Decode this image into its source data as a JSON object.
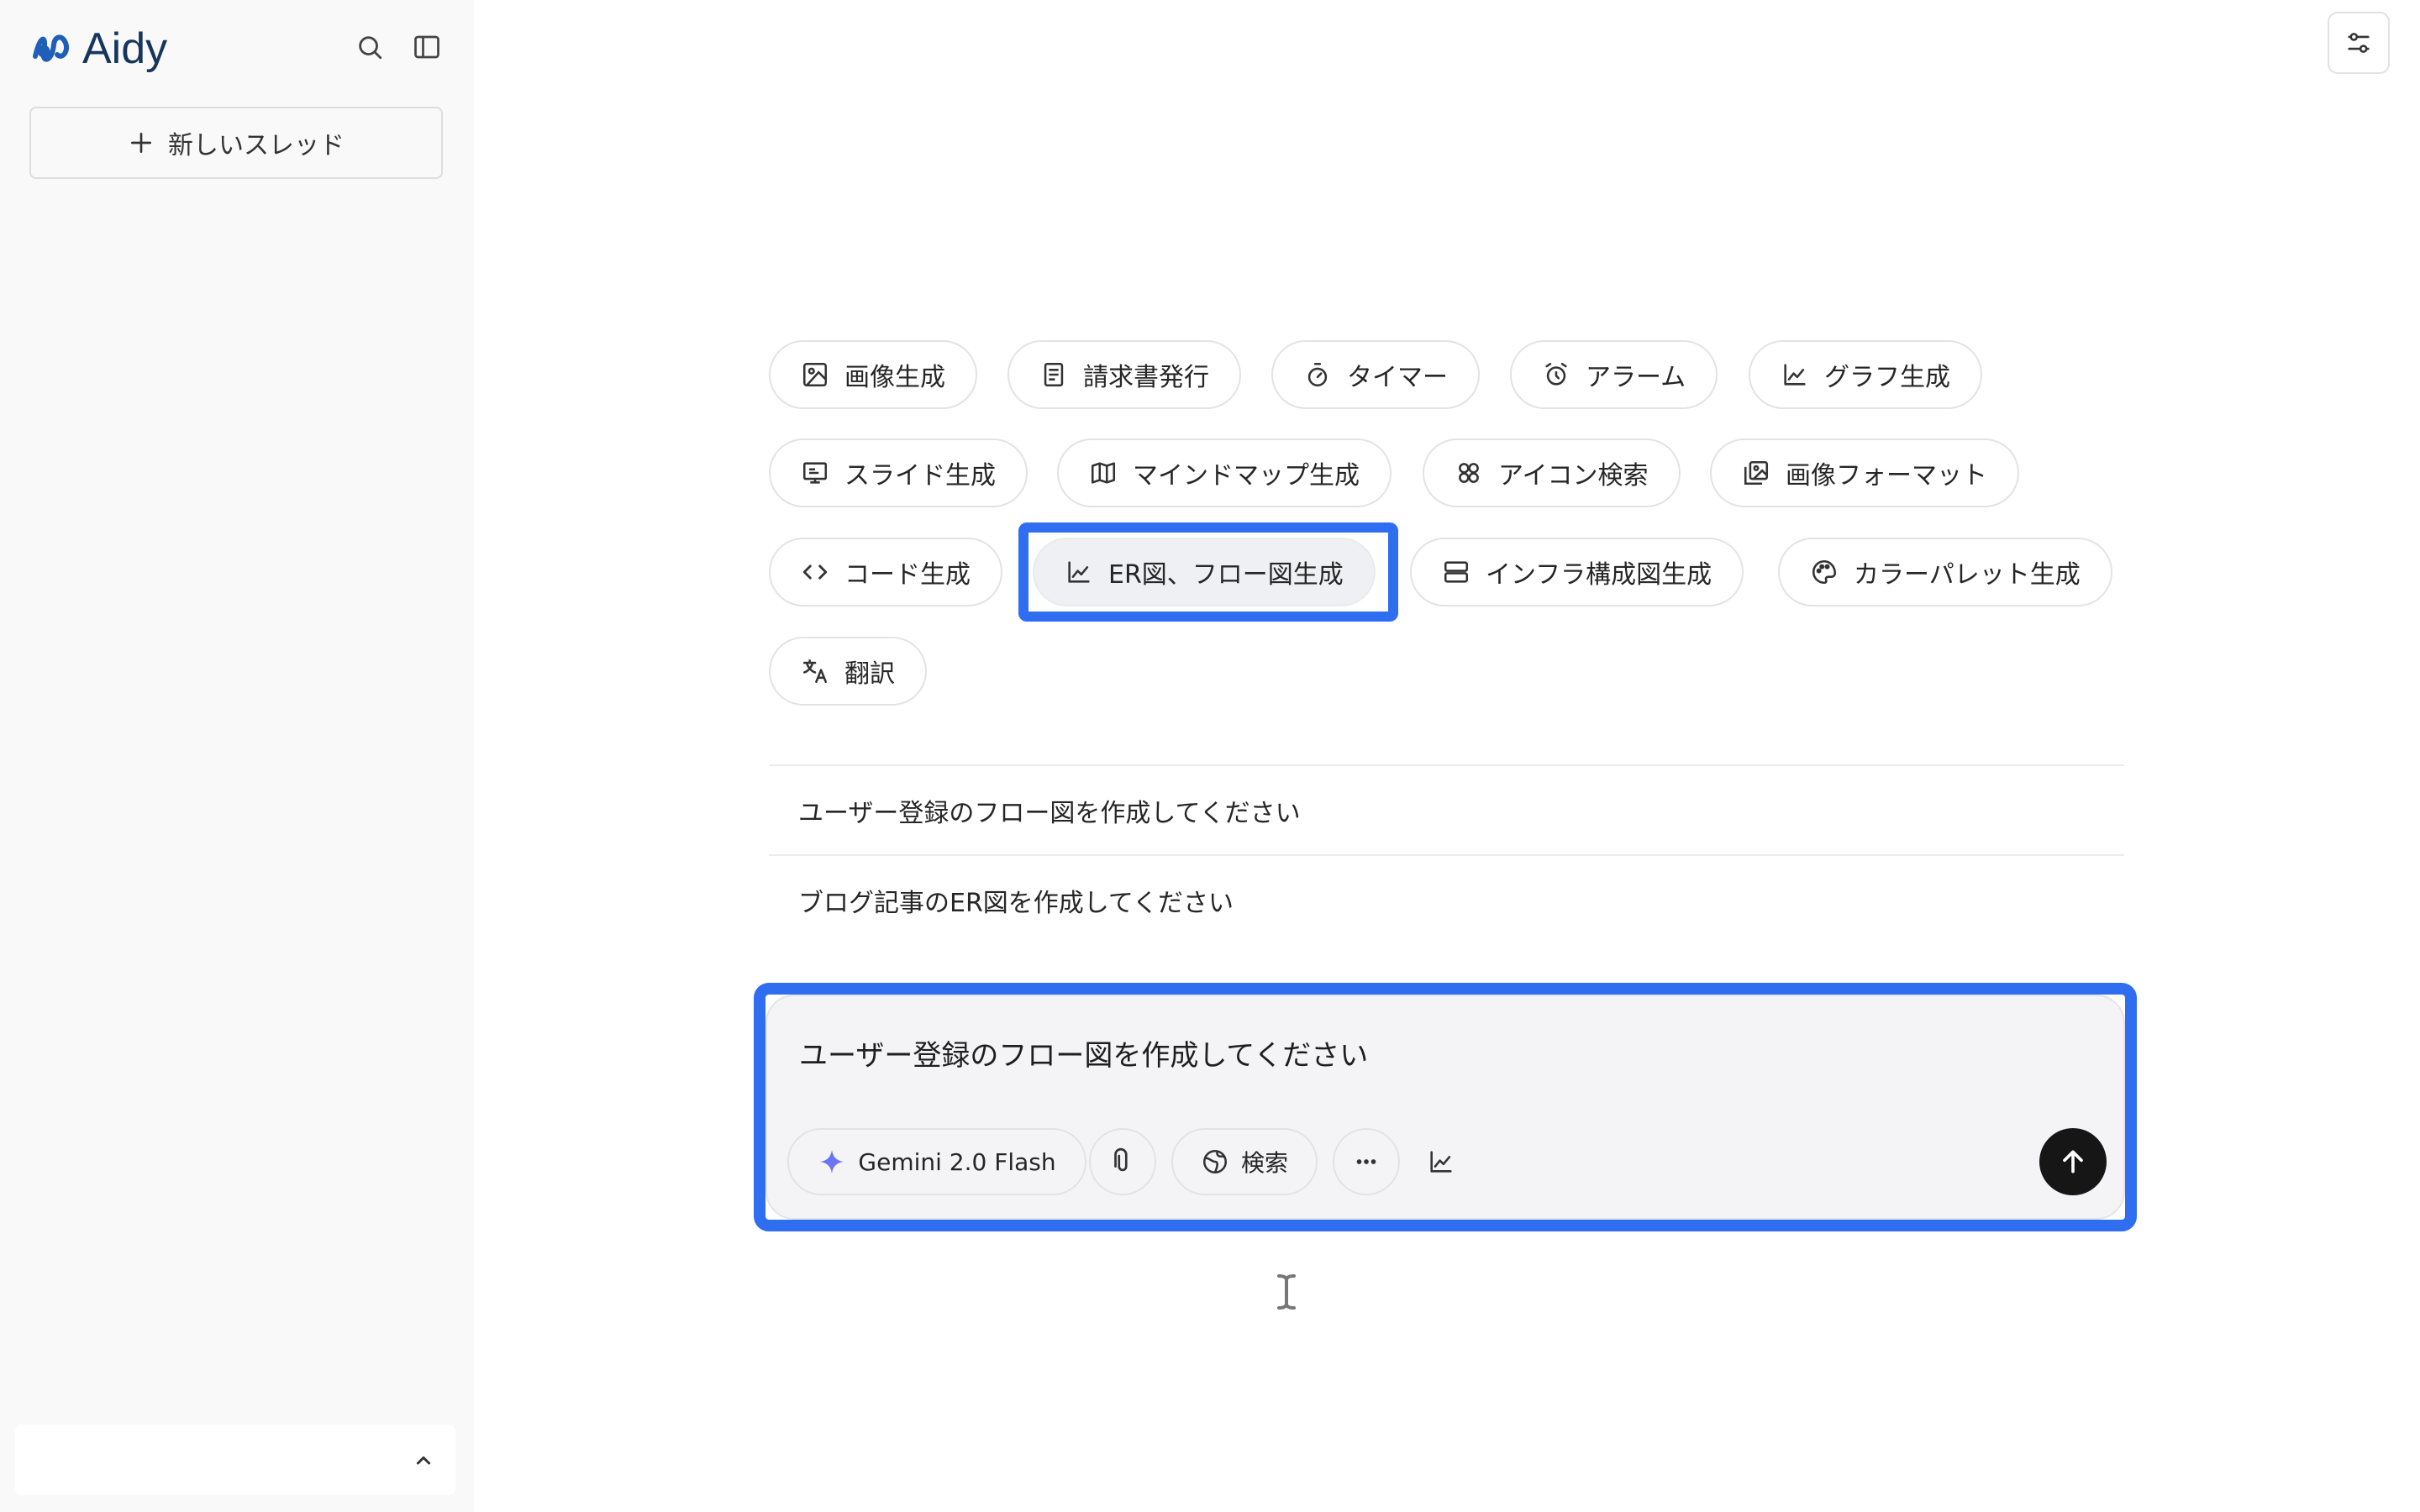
{
  "app": {
    "name": "Aidy",
    "brand_color": "#17365d",
    "accent_color": "#2f6ef0"
  },
  "sidebar": {
    "new_thread_label": "新しいスレッド",
    "icons": [
      "search-icon",
      "sidebar-toggle-icon",
      "chevron-up-icon"
    ]
  },
  "chips": [
    {
      "label": "画像生成",
      "icon": "image-icon"
    },
    {
      "label": "請求書発行",
      "icon": "document-icon"
    },
    {
      "label": "タイマー",
      "icon": "stopwatch-icon"
    },
    {
      "label": "アラーム",
      "icon": "alarm-clock-icon"
    },
    {
      "label": "グラフ生成",
      "icon": "chart-icon"
    },
    {
      "label": "スライド生成",
      "icon": "presentation-icon"
    },
    {
      "label": "マインドマップ生成",
      "icon": "map-icon"
    },
    {
      "label": "アイコン検索",
      "icon": "icons-grid-icon"
    },
    {
      "label": "画像フォーマット",
      "icon": "images-icon"
    },
    {
      "label": "コード生成",
      "icon": "code-icon"
    },
    {
      "label": "ER図、フロー図生成",
      "icon": "chart-icon",
      "selected": true
    },
    {
      "label": "インフラ構成図生成",
      "icon": "server-icon"
    },
    {
      "label": "カラーパレット生成",
      "icon": "palette-icon"
    },
    {
      "label": "翻訳",
      "icon": "translate-icon"
    }
  ],
  "suggestions": [
    "ユーザー登録のフロー図を作成してください",
    "ブログ記事のER図を作成してください"
  ],
  "composer": {
    "value": "ユーザー登録のフロー図を作成してください",
    "model_label": "Gemini 2.0 Flash",
    "search_label": "検索",
    "icons": [
      "sparkle-icon",
      "paperclip-icon",
      "globe-icon",
      "more-icon",
      "chart-icon",
      "arrow-up-icon"
    ]
  }
}
